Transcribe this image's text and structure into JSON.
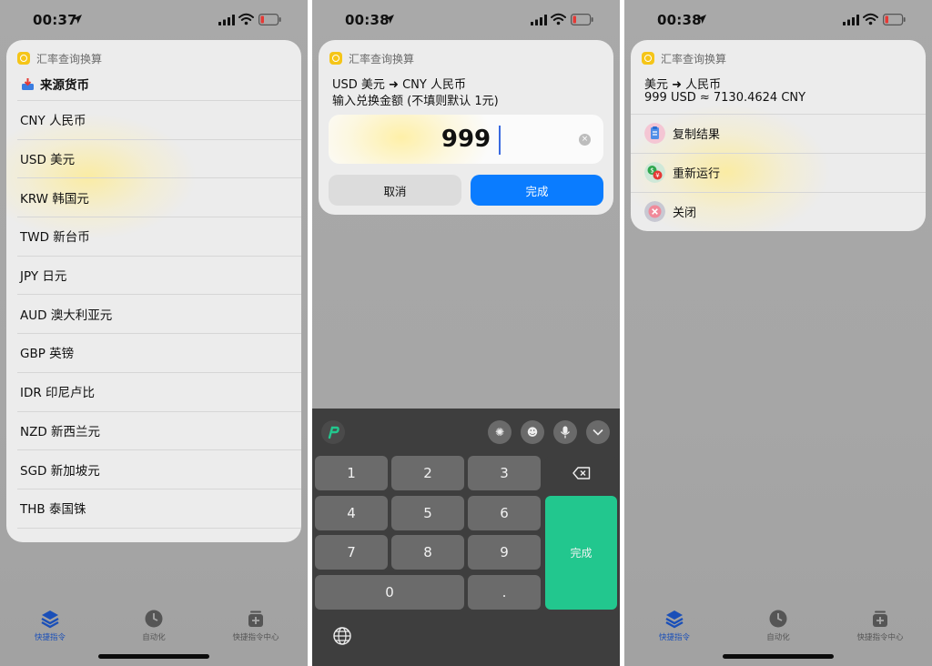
{
  "status": {
    "time": "00:37",
    "time2": "00:38",
    "time3": "00:38"
  },
  "app": {
    "name": "汇率查询换算"
  },
  "panel1": {
    "source_label": "来源货币",
    "currencies": [
      "CNY 人民币",
      "USD 美元",
      "KRW 韩国元",
      "TWD 新台币",
      "JPY 日元",
      "AUD 澳大利亚元",
      "GBP 英镑",
      "IDR 印尼卢比",
      "NZD 新西兰元",
      "SGD 新加坡元",
      "THB 泰国铢"
    ]
  },
  "panel2": {
    "prompt_line1": "USD 美元 ➜ CNY 人民币",
    "prompt_line2": "输入兑换金额 (不填则默认 1元)",
    "amount": "999",
    "cancel_label": "取消",
    "done_label": "完成",
    "keys": [
      "1",
      "2",
      "3",
      "4",
      "5",
      "6",
      "7",
      "8",
      "9",
      "0",
      "."
    ],
    "keyboard_done": "完成"
  },
  "panel3": {
    "result_line1": "美元 ➜ 人民币",
    "result_line2": "999 USD ≈ 7130.4624 CNY",
    "actions": [
      "复制结果",
      "重新运行",
      "关闭"
    ]
  },
  "tabs": [
    "快捷指令",
    "自动化",
    "快捷指令中心"
  ],
  "colors": {
    "accent": "#0a7cff",
    "keyboard_green": "#22c78e",
    "tab_active": "#1a4fb8",
    "app_icon": "#f5c518"
  }
}
